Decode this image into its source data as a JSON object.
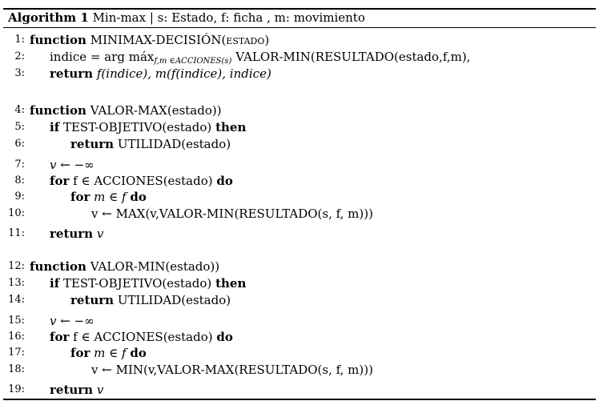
{
  "caption": {
    "label": "Algorithm 1",
    "text": "Min-max | s: Estado, f: ficha , m: movimiento"
  },
  "lines": [
    {
      "num": "1:",
      "kw": "function",
      "rest": "MINIMAX-DECISIÓN(estado)"
    },
    {
      "num": "2:",
      "text": "indice = arg máx",
      "sub": "f,m ∈ACCIONES(s)",
      "rest": "VALOR-MIN(RESULTADO(estado,f,m),"
    },
    {
      "num": "3:",
      "kw": "return",
      "rest": "f(indice), m(f(indice), indice)"
    },
    {
      "num": "4:",
      "kw": "function",
      "rest": "VALOR-MAX(estado))"
    },
    {
      "num": "5:",
      "kw": "if",
      "rest": "TEST-OBJETIVO(estado)",
      "kw2": "then"
    },
    {
      "num": "6:",
      "kw": "return",
      "rest": "UTILIDAD(estado)"
    },
    {
      "num": "7:",
      "text": "v ← −∞"
    },
    {
      "num": "8:",
      "kw": "for",
      "rest": "f ∈ ACCIONES(estado)",
      "kw2": "do"
    },
    {
      "num": "9:",
      "kw": "for",
      "rest": "m ∈ f",
      "kw2": "do"
    },
    {
      "num": "10:",
      "text": "v ← MAX(v,VALOR-MIN(RESULTADO(s, f, m)))"
    },
    {
      "num": "11:",
      "kw": "return",
      "rest": "v"
    },
    {
      "num": "12:",
      "kw": "function",
      "rest": "VALOR-MIN(estado))"
    },
    {
      "num": "13:",
      "kw": "if",
      "rest": "TEST-OBJETIVO(estado)",
      "kw2": "then"
    },
    {
      "num": "14:",
      "kw": "return",
      "rest": "UTILIDAD(estado)"
    },
    {
      "num": "15:",
      "text": "v ← −∞"
    },
    {
      "num": "16:",
      "kw": "for",
      "rest": "f ∈ ACCIONES(estado)",
      "kw2": "do"
    },
    {
      "num": "17:",
      "kw": "for",
      "rest": "m ∈ f",
      "kw2": "do"
    },
    {
      "num": "18:",
      "text": "v ← MIN(v,VALOR-MAX(RESULTADO(s, f, m)))"
    },
    {
      "num": "19:",
      "kw": "return",
      "rest": "v"
    }
  ]
}
